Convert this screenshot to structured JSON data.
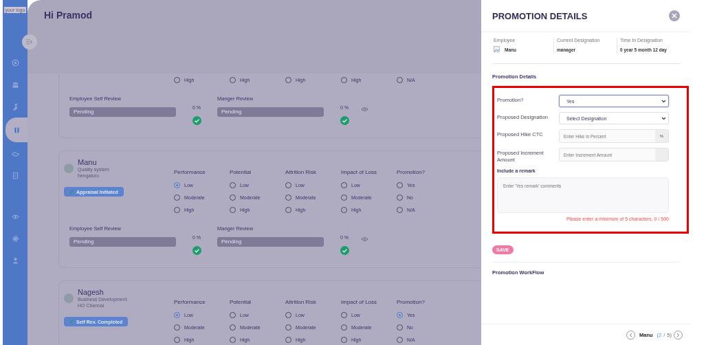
{
  "logo": "your logo",
  "greeting": "Hi Pramod",
  "sidebar": {
    "items": [
      {
        "selected": false
      },
      {
        "selected": false
      },
      {
        "selected": false
      },
      {
        "selected": true
      },
      {
        "selected": false
      },
      {
        "selected": false
      },
      {
        "selected": false
      },
      {
        "selected": false
      },
      {
        "selected": false
      }
    ]
  },
  "employees": [
    {
      "criteria": [
        {
          "options": [
            {
              "label": "High",
              "selected": false
            }
          ]
        },
        {
          "options": [
            {
              "label": "High",
              "selected": false
            }
          ]
        },
        {
          "options": [
            {
              "label": "High",
              "selected": false
            }
          ]
        },
        {
          "options": [
            {
              "label": "High",
              "selected": false
            }
          ]
        },
        {
          "options": [
            {
              "label": "N/A",
              "selected": false
            }
          ]
        }
      ],
      "reviews": [
        {
          "title": "Employee Self Review",
          "placeholder": "Pending",
          "percent": "0 %",
          "done": true
        },
        {
          "title": "Manger Review",
          "placeholder": "Pending",
          "percent": "0 %",
          "done": true
        }
      ]
    },
    {
      "name": "Manu",
      "department": "Quality system",
      "location": "bengaluru",
      "status": "Appraisal Initiated",
      "criteria": [
        {
          "title": "Performance",
          "options": [
            {
              "label": "Low",
              "selected": true
            },
            {
              "label": "Moderate",
              "selected": false
            },
            {
              "label": "High",
              "selected": false
            }
          ]
        },
        {
          "title": "Potential",
          "options": [
            {
              "label": "Low",
              "selected": false
            },
            {
              "label": "Moderate",
              "selected": false
            },
            {
              "label": "High",
              "selected": false
            }
          ]
        },
        {
          "title": "Attrition Risk",
          "options": [
            {
              "label": "Low",
              "selected": false
            },
            {
              "label": "Moderate",
              "selected": false
            },
            {
              "label": "High",
              "selected": false
            }
          ]
        },
        {
          "title": "Impact of Loss",
          "options": [
            {
              "label": "Low",
              "selected": false
            },
            {
              "label": "Moderate",
              "selected": false
            },
            {
              "label": "High",
              "selected": false
            }
          ]
        },
        {
          "title": "Promotion?",
          "options": [
            {
              "label": "Yes",
              "selected": false
            },
            {
              "label": "No",
              "selected": false
            },
            {
              "label": "N/A",
              "selected": false
            }
          ]
        }
      ],
      "reviews": [
        {
          "title": "Employee Self Review",
          "placeholder": "Pending",
          "percent": "0 %",
          "done": true
        },
        {
          "title": "Manger Review",
          "placeholder": "Pending",
          "percent": "0 %",
          "done": true
        }
      ]
    },
    {
      "name": "Nagesh",
      "department": "Business Development",
      "location": "HO Chennai",
      "status": "Self Rev. Completed",
      "criteria": [
        {
          "title": "Performance",
          "options": [
            {
              "label": "Low",
              "selected": true
            },
            {
              "label": "Moderate",
              "selected": false
            },
            {
              "label": "High",
              "selected": false
            }
          ]
        },
        {
          "title": "Potential",
          "options": [
            {
              "label": "Low",
              "selected": false
            },
            {
              "label": "Moderate",
              "selected": false
            },
            {
              "label": "High",
              "selected": false
            }
          ]
        },
        {
          "title": "Attrition Risk",
          "options": [
            {
              "label": "Low",
              "selected": false
            },
            {
              "label": "Moderate",
              "selected": false
            },
            {
              "label": "High",
              "selected": false
            }
          ]
        },
        {
          "title": "Impact of Loss",
          "options": [
            {
              "label": "Low",
              "selected": false
            },
            {
              "label": "Moderate",
              "selected": false
            },
            {
              "label": "High",
              "selected": false
            }
          ]
        },
        {
          "title": "Promotion?",
          "options": [
            {
              "label": "Yes",
              "selected": true
            },
            {
              "label": "No",
              "selected": false
            },
            {
              "label": "N/A",
              "selected": false
            }
          ]
        }
      ]
    }
  ],
  "drawer": {
    "title": "PROMOTION DETAILS",
    "info": [
      {
        "label": "Employee",
        "value": "Manu",
        "kind": "avatar"
      },
      {
        "label": "Current Designation",
        "value": "manager",
        "kind": "text"
      },
      {
        "label": "Time In Designation",
        "value": "0 year 5 month 12 day",
        "kind": "text"
      }
    ],
    "section_title": "Promotion Details",
    "fields": [
      {
        "kind": "select",
        "label": "Promotion?",
        "value": "Yes",
        "focused": true
      },
      {
        "kind": "select",
        "label": "Proposed Designation",
        "value": "Select Designation",
        "focused": false
      },
      {
        "kind": "addon",
        "label": "Proposed Hike CTC",
        "placeholder": "Enter Hike in Percent",
        "addon": "%"
      },
      {
        "kind": "addon",
        "label": "Proposed Increment Amount",
        "placeholder": "Enter Increment Amount"
      }
    ],
    "remark_label": "Include a remark",
    "remark_placeholder": "Enter 'Yes remark' comments",
    "error": "Please enter a minimum of 5 characters. 0 / 500",
    "save": "SAVE",
    "workflow_title": "Promotion WorkFlow",
    "pager": {
      "name": "Manu",
      "current": "2",
      "separator": "/",
      "total": "5)",
      "open": "("
    }
  }
}
